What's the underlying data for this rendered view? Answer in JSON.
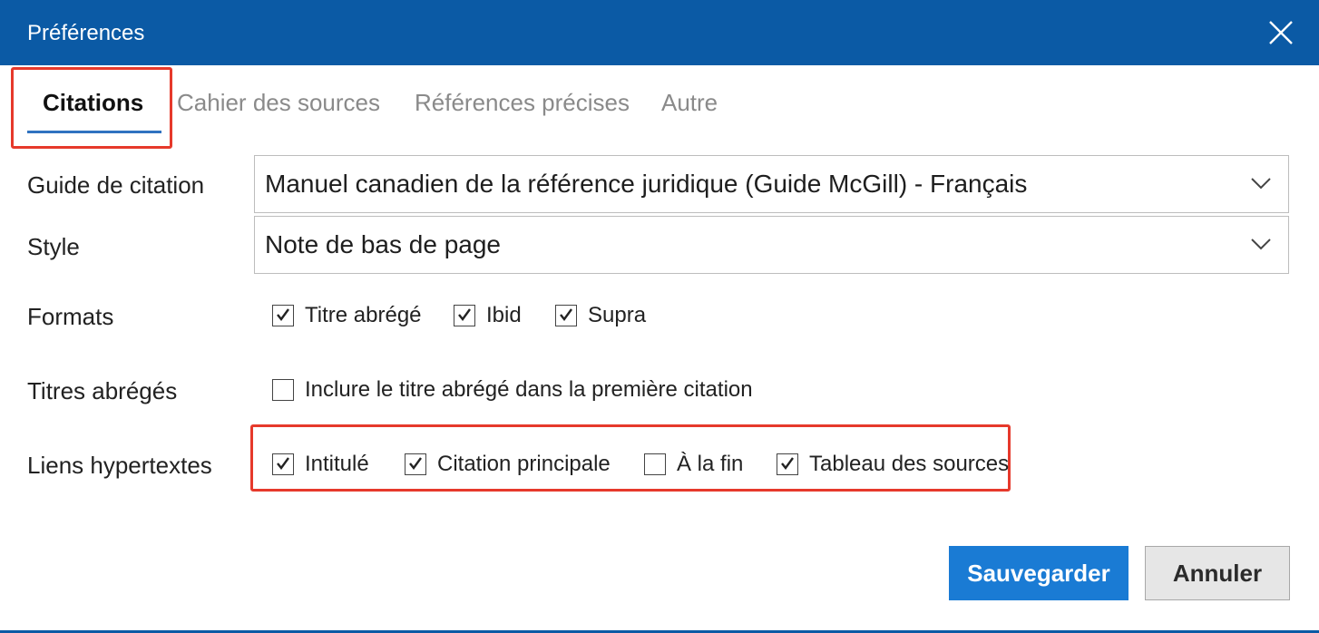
{
  "dialog": {
    "title": "Préférences"
  },
  "tabs": [
    {
      "label": "Citations",
      "active": true
    },
    {
      "label": "Cahier des sources",
      "active": false
    },
    {
      "label": "Références précises",
      "active": false
    },
    {
      "label": "Autre",
      "active": false
    }
  ],
  "guide": {
    "label": "Guide de citation",
    "value": "Manuel canadien de la référence juridique (Guide McGill) - Français"
  },
  "style": {
    "label": "Style",
    "value": "Note de bas de page"
  },
  "formats": {
    "label": "Formats",
    "options": [
      {
        "label": "Titre abrégé",
        "checked": true
      },
      {
        "label": "Ibid",
        "checked": true
      },
      {
        "label": "Supra",
        "checked": true
      }
    ]
  },
  "short_titles": {
    "label": "Titres abrégés",
    "options": [
      {
        "label": "Inclure le titre abrégé dans la première citation",
        "checked": false
      }
    ]
  },
  "hyperlinks": {
    "label": "Liens hypertextes",
    "options": [
      {
        "label": "Intitulé",
        "checked": true
      },
      {
        "label": "Citation principale",
        "checked": true
      },
      {
        "label": "À la fin",
        "checked": false
      },
      {
        "label": "Tableau des sources",
        "checked": true
      }
    ]
  },
  "buttons": {
    "save": "Sauvegarder",
    "cancel": "Annuler"
  },
  "colors": {
    "titlebar": "#0b5aa5",
    "primary": "#1a7bd4",
    "highlight": "#e6392b"
  }
}
